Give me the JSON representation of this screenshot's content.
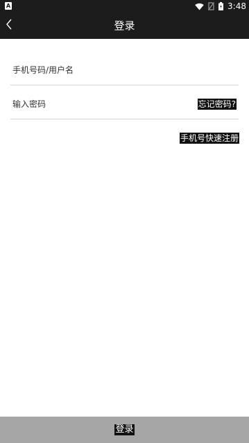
{
  "status_bar": {
    "left_icon": "A",
    "time": "3:48",
    "icons": [
      "wifi-icon",
      "no-sim-icon",
      "battery-icon"
    ]
  },
  "header": {
    "title": "登录",
    "back_icon": "chevron-left-icon"
  },
  "form": {
    "username_placeholder": "手机号码/用户名",
    "password_placeholder": "输入密码",
    "forgot_password": "忘记密码?",
    "quick_register": "手机号快速注册"
  },
  "footer": {
    "login_label": "登录"
  },
  "colors": {
    "bar_background": "#1c1c1c",
    "login_button_background": "#a6a6a6",
    "divider": "#d4d4d4"
  }
}
